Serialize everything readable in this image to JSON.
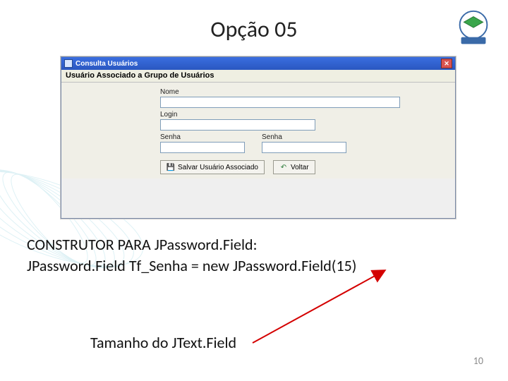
{
  "slide": {
    "title": "Opção 05",
    "page_number": "10"
  },
  "window": {
    "title": "Consulta Usuários",
    "panel_title": "Usuário Associado a Grupo de Usuários",
    "labels": {
      "nome": "Nome",
      "login": "Login",
      "senha": "Senha",
      "senha2": "Senha"
    },
    "buttons": {
      "save": "Salvar Usuário Associado",
      "back": "Voltar"
    },
    "values": {
      "nome": "",
      "login": "",
      "senha": "",
      "senha2": ""
    }
  },
  "code": {
    "line1": "CONSTRUTOR PARA JPassword.Field:",
    "line2": "JPassword.Field Tf_Senha = new JPassword.Field(15)",
    "caption": "Tamanho do JText.Field"
  }
}
